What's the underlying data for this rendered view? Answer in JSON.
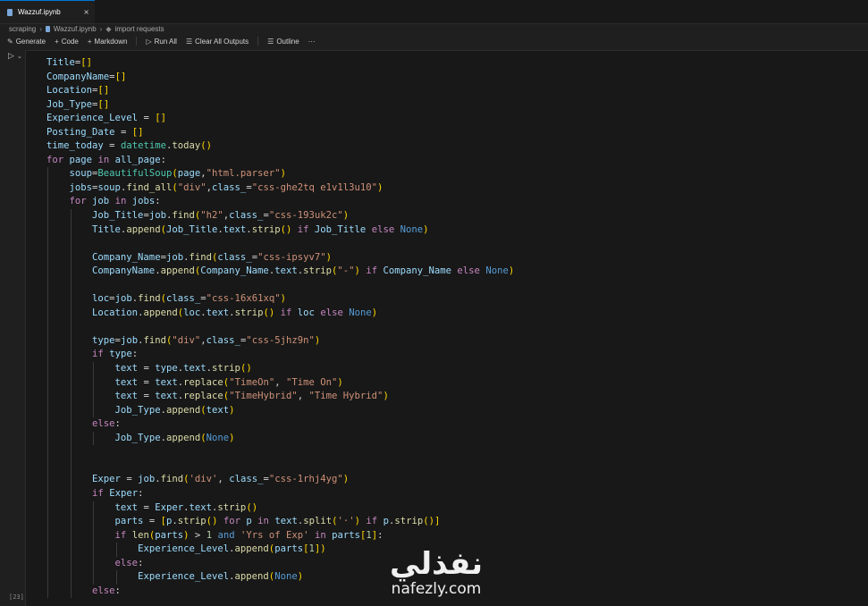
{
  "tab": {
    "filename": "Wazzuf.ipynb",
    "close": "×"
  },
  "breadcrumb": {
    "folder": "scraping",
    "file": "Wazzuf.ipynb",
    "symbol": "import requests"
  },
  "toolbar": {
    "generate": "Generate",
    "code": "Code",
    "markdown": "Markdown",
    "run_all": "Run All",
    "clear_all": "Clear All Outputs",
    "outline": "Outline",
    "more": "···"
  },
  "cell": {
    "status": "[23]"
  },
  "watermark": {
    "arabic": "نفذلي",
    "latin": "nafezly.com"
  },
  "code_lines": [
    "Title=[]",
    "CompanyName=[]",
    "Location=[]",
    "Job_Type=[]",
    "Experience_Level = []",
    "Posting_Date = []",
    "time_today = datetime.today()",
    "for page in all_page:",
    "    soup=BeautifulSoup(page,\"html.parser\")",
    "    jobs=soup.find_all(\"div\",class_=\"css-ghe2tq e1v1l3u10\")",
    "    for job in jobs:",
    "        Job_Title=job.find(\"h2\",class_=\"css-193uk2c\")",
    "        Title.append(Job_Title.text.strip() if Job_Title else None)",
    "",
    "        Company_Name=job.find(class_=\"css-ipsyv7\")",
    "        CompanyName.append(Company_Name.text.strip(\"-\") if Company_Name else None)",
    "",
    "        loc=job.find(class_=\"css-16x61xq\")",
    "        Location.append(loc.text.strip() if loc else None)",
    "",
    "        type=job.find(\"div\",class_=\"css-5jhz9n\")",
    "        if type:",
    "            text = type.text.strip()",
    "            text = text.replace(\"TimeOn\", \"Time On\")",
    "            text = text.replace(\"TimeHybrid\", \"Time Hybrid\")",
    "            Job_Type.append(text)",
    "        else:",
    "            Job_Type.append(None)",
    "",
    "",
    "        Exper = job.find('div', class_=\"css-1rhj4yg\")",
    "        if Exper:",
    "            text = Exper.text.strip()",
    "            parts = [p.strip() for p in text.split('·') if p.strip()]",
    "            if len(parts) > 1 and 'Yrs of Exp' in parts[1]:",
    "                Experience_Level.append(parts[1])",
    "            else:",
    "                Experience_Level.append(None)",
    "        else:"
  ]
}
